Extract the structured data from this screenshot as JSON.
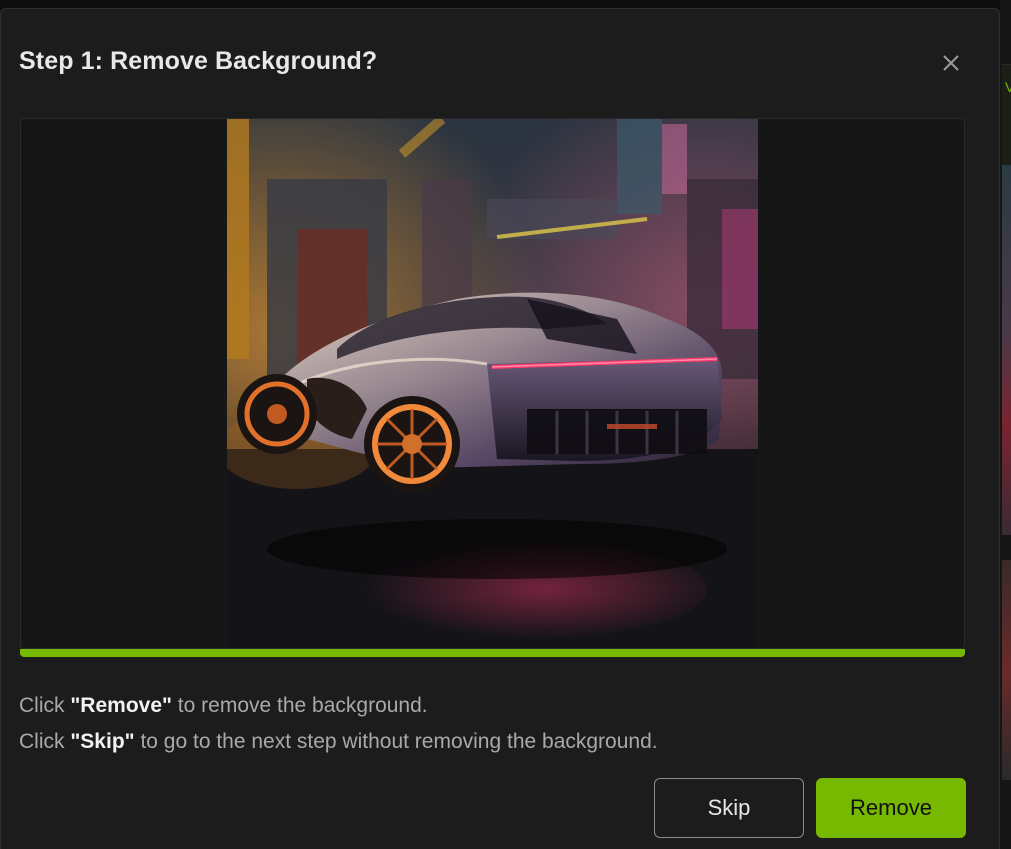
{
  "dialog": {
    "title": "Step 1: Remove Background?",
    "close_icon": "close-icon"
  },
  "preview": {
    "image_subject": "futuristic chrome sports car on wet neon-lit street",
    "progress_percent": 100
  },
  "description": {
    "line1_prefix": "Click ",
    "line1_emphasis": "\"Remove\"",
    "line1_suffix": " to remove the background.",
    "line2_prefix": "Click ",
    "line2_emphasis": "\"Skip\"",
    "line2_suffix": " to go to the next step without removing the background."
  },
  "buttons": {
    "skip_label": "Skip",
    "remove_label": "Remove"
  },
  "background_app": {
    "partial_text": "V"
  },
  "colors": {
    "accent": "#76b900",
    "dialog_bg": "#1c1c1c",
    "text_primary": "#e8e8e8",
    "text_secondary": "#a9a9a9"
  }
}
